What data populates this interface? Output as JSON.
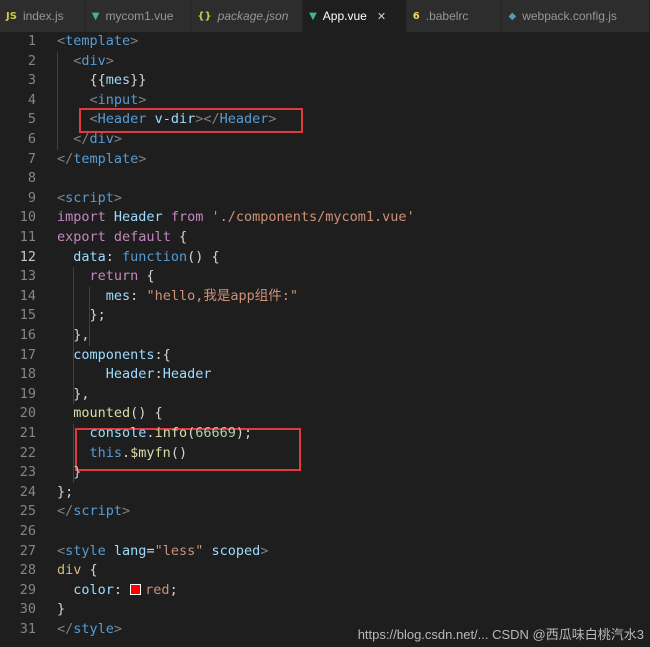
{
  "tabs": [
    {
      "label": "index.js",
      "icon": "JS",
      "icon_name": "js-file-icon",
      "icon_color": "#cbcb41",
      "italic": false,
      "active": false
    },
    {
      "label": "mycom1.vue",
      "icon": "▼",
      "icon_name": "vue-file-icon",
      "icon_color": "#41b883",
      "italic": false,
      "active": false
    },
    {
      "label": "package.json",
      "icon": "{}",
      "icon_name": "json-file-icon",
      "icon_color": "#cbcb41",
      "italic": true,
      "active": false
    },
    {
      "label": "App.vue",
      "icon": "▼",
      "icon_name": "vue-file-icon",
      "icon_color": "#41b883",
      "italic": false,
      "active": true
    },
    {
      "label": ".babelrc",
      "icon": "6",
      "icon_name": "babel-file-icon",
      "icon_color": "#f5da55",
      "italic": false,
      "active": false
    },
    {
      "label": "webpack.config.js",
      "icon": "◆",
      "icon_name": "webpack-file-icon",
      "icon_color": "#519aba",
      "italic": false,
      "active": false
    }
  ],
  "active_line": 12,
  "lines": [
    {
      "n": 1,
      "tokens": [
        [
          "t-br",
          "<"
        ],
        [
          "t-tag",
          "template"
        ],
        [
          "t-br",
          ">"
        ]
      ]
    },
    {
      "n": 2,
      "tokens": [
        [
          "t-pl",
          "  "
        ],
        [
          "t-br",
          "<"
        ],
        [
          "t-tag",
          "div"
        ],
        [
          "t-br",
          ">"
        ]
      ]
    },
    {
      "n": 3,
      "tokens": [
        [
          "t-pl",
          "    {{"
        ],
        [
          "t-attr",
          "mes"
        ],
        [
          "t-pl",
          "}}"
        ]
      ]
    },
    {
      "n": 4,
      "tokens": [
        [
          "t-pl",
          "    "
        ],
        [
          "t-br",
          "<"
        ],
        [
          "t-tag",
          "input"
        ],
        [
          "t-br",
          ">"
        ]
      ]
    },
    {
      "n": 5,
      "tokens": [
        [
          "t-pl",
          "    "
        ],
        [
          "t-br",
          "<"
        ],
        [
          "t-tag",
          "Header"
        ],
        [
          "t-pl",
          " "
        ],
        [
          "t-attr",
          "v-dir"
        ],
        [
          "t-br",
          "></"
        ],
        [
          "t-tag",
          "Header"
        ],
        [
          "t-br",
          ">"
        ]
      ]
    },
    {
      "n": 6,
      "tokens": [
        [
          "t-pl",
          "  "
        ],
        [
          "t-br",
          "</"
        ],
        [
          "t-tag",
          "div"
        ],
        [
          "t-br",
          ">"
        ]
      ]
    },
    {
      "n": 7,
      "tokens": [
        [
          "t-br",
          "</"
        ],
        [
          "t-tag",
          "template"
        ],
        [
          "t-br",
          ">"
        ]
      ]
    },
    {
      "n": 8,
      "tokens": []
    },
    {
      "n": 9,
      "tokens": [
        [
          "t-br",
          "<"
        ],
        [
          "t-tag",
          "script"
        ],
        [
          "t-br",
          ">"
        ]
      ]
    },
    {
      "n": 10,
      "tokens": [
        [
          "t-kw",
          "import"
        ],
        [
          "t-pl",
          " "
        ],
        [
          "t-prop",
          "Header"
        ],
        [
          "t-pl",
          " "
        ],
        [
          "t-kw",
          "from"
        ],
        [
          "t-pl",
          " "
        ],
        [
          "t-str",
          "'./components/mycom1.vue'"
        ]
      ]
    },
    {
      "n": 11,
      "tokens": [
        [
          "t-kw",
          "export"
        ],
        [
          "t-pl",
          " "
        ],
        [
          "t-kw",
          "default"
        ],
        [
          "t-pl",
          " {"
        ]
      ]
    },
    {
      "n": 12,
      "tokens": [
        [
          "t-pl",
          "  "
        ],
        [
          "t-prop",
          "data"
        ],
        [
          "t-pl",
          ": "
        ],
        [
          "t-kb",
          "function"
        ],
        [
          "t-pl",
          "() "
        ],
        [
          "t-pl",
          "{"
        ]
      ]
    },
    {
      "n": 13,
      "tokens": [
        [
          "t-pl",
          "    "
        ],
        [
          "t-kw",
          "return"
        ],
        [
          "t-pl",
          " {"
        ]
      ]
    },
    {
      "n": 14,
      "tokens": [
        [
          "t-pl",
          "      "
        ],
        [
          "t-prop",
          "mes"
        ],
        [
          "t-pl",
          ": "
        ],
        [
          "t-str",
          "\"hello,我是app组件:\""
        ]
      ]
    },
    {
      "n": 15,
      "tokens": [
        [
          "t-pl",
          "    };"
        ]
      ]
    },
    {
      "n": 16,
      "tokens": [
        [
          "t-pl",
          "  "
        ],
        [
          "t-pl",
          "}"
        ],
        [
          "t-pl",
          ","
        ]
      ]
    },
    {
      "n": 17,
      "tokens": [
        [
          "t-pl",
          "  "
        ],
        [
          "t-prop",
          "components"
        ],
        [
          "t-pl",
          ":{"
        ]
      ]
    },
    {
      "n": 18,
      "tokens": [
        [
          "t-pl",
          "      "
        ],
        [
          "t-prop",
          "Header"
        ],
        [
          "t-pl",
          ":"
        ],
        [
          "t-prop",
          "Header"
        ]
      ]
    },
    {
      "n": 19,
      "tokens": [
        [
          "t-pl",
          "  },"
        ]
      ]
    },
    {
      "n": 20,
      "tokens": [
        [
          "t-pl",
          "  "
        ],
        [
          "t-fn",
          "mounted"
        ],
        [
          "t-pl",
          "() {"
        ]
      ]
    },
    {
      "n": 21,
      "tokens": [
        [
          "t-pl",
          "    "
        ],
        [
          "t-prop",
          "console"
        ],
        [
          "t-pl",
          "."
        ],
        [
          "t-fn",
          "info"
        ],
        [
          "t-pl",
          "("
        ],
        [
          "t-num",
          "66669"
        ],
        [
          "t-pl",
          ");"
        ]
      ]
    },
    {
      "n": 22,
      "tokens": [
        [
          "t-pl",
          "    "
        ],
        [
          "t-kb",
          "this"
        ],
        [
          "t-pl",
          "."
        ],
        [
          "t-fn",
          "$myfn"
        ],
        [
          "t-pl",
          "()"
        ]
      ]
    },
    {
      "n": 23,
      "tokens": [
        [
          "t-pl",
          "  }"
        ]
      ]
    },
    {
      "n": 24,
      "tokens": [
        [
          "t-pl",
          "};"
        ]
      ]
    },
    {
      "n": 25,
      "tokens": [
        [
          "t-br",
          "</"
        ],
        [
          "t-tag",
          "script"
        ],
        [
          "t-br",
          ">"
        ]
      ]
    },
    {
      "n": 26,
      "tokens": []
    },
    {
      "n": 27,
      "tokens": [
        [
          "t-br",
          "<"
        ],
        [
          "t-tag",
          "style"
        ],
        [
          "t-pl",
          " "
        ],
        [
          "t-attr",
          "lang"
        ],
        [
          "t-pl",
          "="
        ],
        [
          "t-str",
          "\"less\""
        ],
        [
          "t-pl",
          " "
        ],
        [
          "t-attr",
          "scoped"
        ],
        [
          "t-br",
          ">"
        ]
      ]
    },
    {
      "n": 28,
      "tokens": [
        [
          "t-sel",
          "div"
        ],
        [
          "t-pl",
          " {"
        ]
      ]
    },
    {
      "n": 29,
      "tokens": [
        [
          "t-pl",
          "  "
        ],
        [
          "t-prop",
          "color"
        ],
        [
          "t-pl",
          ": "
        ],
        [
          "swatch",
          ""
        ],
        [
          "t-str",
          "red"
        ],
        [
          "t-pl",
          ";"
        ]
      ]
    },
    {
      "n": 30,
      "tokens": [
        [
          "t-pl",
          "}"
        ]
      ]
    },
    {
      "n": 31,
      "tokens": [
        [
          "t-br",
          "</"
        ],
        [
          "t-tag",
          "style"
        ],
        [
          "t-br",
          ">"
        ]
      ]
    }
  ],
  "swatch_color": "#ff0000",
  "highlight_color": "#e0393e",
  "watermark": "https://blog.csdn.net/... CSDN @西瓜味白桃汽水3"
}
